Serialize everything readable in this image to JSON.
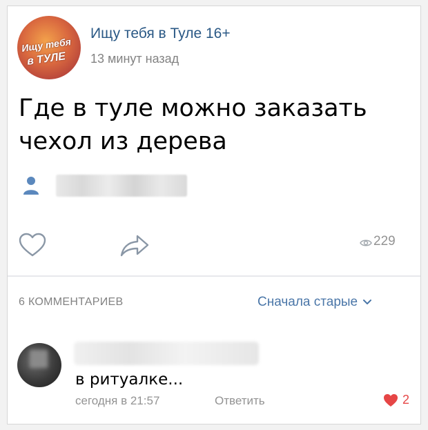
{
  "post": {
    "group": {
      "name": "Ищу тебя в Туле 16+",
      "avatar_text_line1": "Ищу тебя",
      "avatar_text_line2": "в ТУЛЕ"
    },
    "time": "13 минут назад",
    "text": "Где в туле можно заказать\nчехол из дерева",
    "views": "229"
  },
  "comments_section": {
    "count_label": "6 КОММЕНТАРИЕВ",
    "sort_label": "Сначала старые",
    "items": [
      {
        "text": "в ритуалке...",
        "time": "сегодня в 21:57",
        "reply_label": "Ответить",
        "likes": "2"
      }
    ]
  },
  "colors": {
    "link": "#2a5885",
    "accent": "#4a76a8",
    "muted": "#828282",
    "like_active": "#e64646"
  },
  "icons": [
    "person-icon",
    "heart-outline-icon",
    "share-icon",
    "eye-icon",
    "chevron-down-icon",
    "heart-filled-icon"
  ]
}
